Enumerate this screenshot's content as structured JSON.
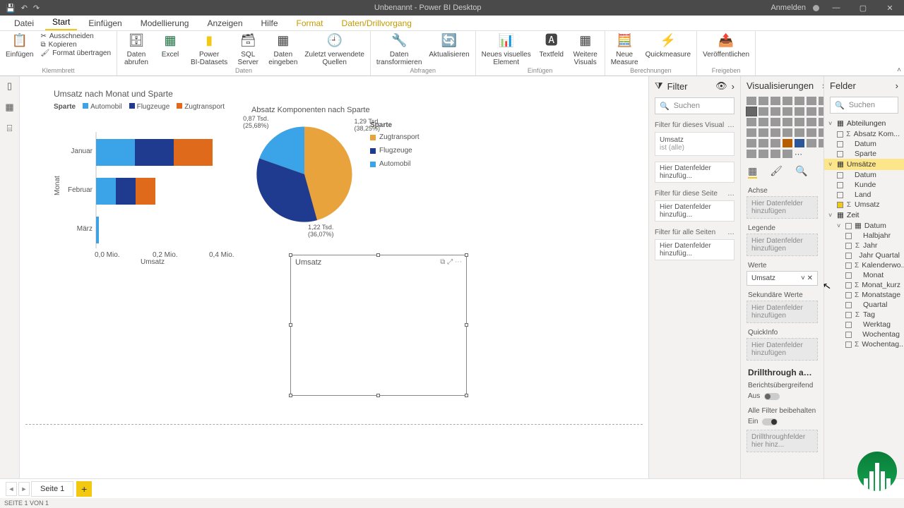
{
  "title": "Unbenannt - Power BI Desktop",
  "titlebar": {
    "signin": "Anmelden"
  },
  "tabs": [
    "Datei",
    "Start",
    "Einfügen",
    "Modellierung",
    "Anzeigen",
    "Hilfe",
    "Format",
    "Daten/Drillvorgang"
  ],
  "active_tab": 1,
  "ribbon": {
    "clipboard": {
      "label": "Klemmbrett",
      "paste": "Einfügen",
      "cut": "Ausschneiden",
      "copy": "Kopieren",
      "format": "Format übertragen"
    },
    "data": {
      "label": "Daten",
      "get": "Daten\nabrufen",
      "excel": "Excel",
      "pbi": "Power\nBI-Datasets",
      "sql": "SQL\nServer",
      "enter": "Daten\neingeben",
      "recent": "Zuletzt verwendete\nQuellen"
    },
    "queries": {
      "label": "Abfragen",
      "transform": "Daten\ntransformieren",
      "refresh": "Aktualisieren"
    },
    "insert": {
      "label": "Einfügen",
      "visual": "Neues visuelles\nElement",
      "text": "Textfeld",
      "more": "Weitere\nVisuals"
    },
    "calc": {
      "label": "Berechnungen",
      "measure": "Neue\nMeasure",
      "quick": "Quickmeasure"
    },
    "share": {
      "label": "Freigeben",
      "publish": "Veröffentlichen"
    }
  },
  "bar_chart": {
    "title": "Umsatz nach Monat und Sparte",
    "legend_label": "Sparte",
    "legend": [
      "Automobil",
      "Flugzeuge",
      "Zugtransport"
    ],
    "yaxis": "Monat",
    "xaxis": "Umsatz",
    "months": [
      "Januar",
      "Februar",
      "März"
    ],
    "ticks": [
      "0,0 Mio.",
      "0,2 Mio.",
      "0,4 Mio."
    ]
  },
  "pie_chart": {
    "title": "Absatz Komponenten nach Sparte",
    "legend_label": "Sparte",
    "slices": [
      {
        "name": "Zugtransport",
        "label": "1,29 Tsd.",
        "pct": "(38,25%)",
        "color": "#e8a33d"
      },
      {
        "name": "Flugzeuge",
        "label": "1,22 Tsd.",
        "pct": "(36,07%)",
        "color": "#1f3b8f"
      },
      {
        "name": "Automobil",
        "label": "0,87 Tsd.",
        "pct": "(25,68%)",
        "color": "#3ba3e8"
      }
    ]
  },
  "selected_visual_title": "Umsatz",
  "filter": {
    "header": "Filter",
    "search": "Suchen",
    "visual_lbl": "Filter für dieses Visual",
    "card_field": "Umsatz",
    "card_state": "ist (alle)",
    "page_lbl": "Filter für diese Seite",
    "all_lbl": "Filter für alle Seiten",
    "drop": "Hier Datenfelder hinzufüg..."
  },
  "viz": {
    "header": "Visualisierungen",
    "axis": "Achse",
    "legend": "Legende",
    "values": "Werte",
    "value_field": "Umsatz",
    "secondary": "Sekundäre Werte",
    "tooltip": "QuickInfo",
    "drop": "Hier Datenfelder hinzufügen",
    "drill": "Drillthrough ausfü…",
    "cross": "Berichtsübergreifend",
    "off": "Aus",
    "keep": "Alle Filter beibehalten",
    "on": "Ein",
    "drill_drop": "Drillthroughfelder hier hinz..."
  },
  "fields": {
    "header": "Felder",
    "search": "Suchen",
    "abteilungen": "Abteilungen",
    "abteilungen_items": [
      {
        "n": "Absatz Kom...",
        "s": true
      },
      {
        "n": "Datum"
      },
      {
        "n": "Sparte"
      }
    ],
    "umsaetze": "Umsätze",
    "umsaetze_items": [
      {
        "n": "Datum"
      },
      {
        "n": "Kunde"
      },
      {
        "n": "Land"
      },
      {
        "n": "Umsatz",
        "s": true,
        "chk": true
      }
    ],
    "zeit": "Zeit",
    "datum": "Datum",
    "zeit_items": [
      {
        "n": "Halbjahr"
      },
      {
        "n": "Jahr",
        "s": true
      },
      {
        "n": "Jahr Quartal"
      },
      {
        "n": "Kalenderwo...",
        "s": true
      },
      {
        "n": "Monat"
      },
      {
        "n": "Monat_kurz",
        "s": true
      },
      {
        "n": "Monatstage",
        "s": true
      },
      {
        "n": "Quartal"
      },
      {
        "n": "Tag",
        "s": true
      },
      {
        "n": "Werktag"
      },
      {
        "n": "Wochentag"
      },
      {
        "n": "Wochentag...",
        "s": true
      }
    ]
  },
  "page_tab": "Seite 1",
  "footer": "SEITE 1 VON 1",
  "chart_data": [
    {
      "type": "bar",
      "orientation": "horizontal-stacked",
      "title": "Umsatz nach Monat und Sparte",
      "ylabel": "Monat",
      "xlabel": "Umsatz",
      "categories": [
        "Januar",
        "Februar",
        "März"
      ],
      "series": [
        {
          "name": "Automobil",
          "color": "#3ba3e8",
          "values": [
            0.14,
            0.07,
            0.01
          ]
        },
        {
          "name": "Flugzeuge",
          "color": "#1f3b8f",
          "values": [
            0.14,
            0.07,
            0.0
          ]
        },
        {
          "name": "Zugtransport",
          "color": "#e06a1c",
          "values": [
            0.14,
            0.07,
            0.0
          ]
        }
      ],
      "xlim": [
        0,
        0.45
      ],
      "x_ticks": [
        0.0,
        0.2,
        0.4
      ],
      "x_tick_labels": [
        "0,0 Mio.",
        "0,2 Mio.",
        "0,4 Mio."
      ]
    },
    {
      "type": "pie",
      "title": "Absatz Komponenten nach Sparte",
      "slices": [
        {
          "name": "Zugtransport",
          "value": 1290,
          "pct": 38.25,
          "color": "#e8a33d"
        },
        {
          "name": "Flugzeuge",
          "value": 1220,
          "pct": 36.07,
          "color": "#1f3b8f"
        },
        {
          "name": "Automobil",
          "value": 870,
          "pct": 25.68,
          "color": "#3ba3e8"
        }
      ]
    }
  ]
}
